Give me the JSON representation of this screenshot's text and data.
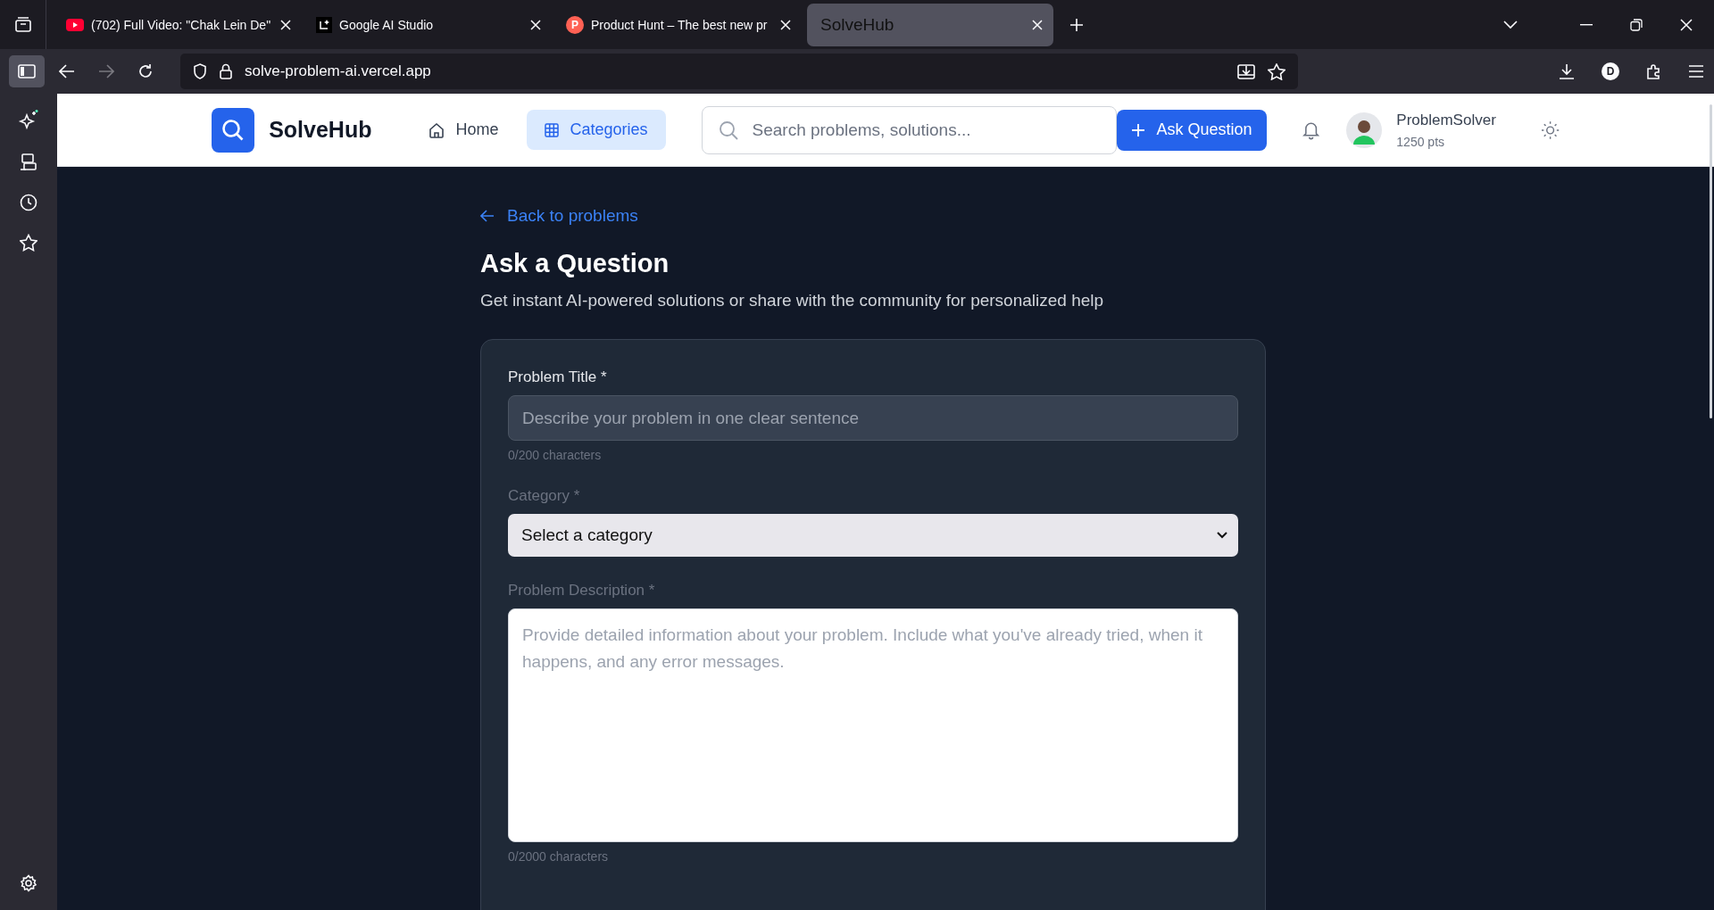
{
  "browser": {
    "tabs": [
      {
        "title": "(702) Full Video: \"Chak Lein De\"",
        "selected": false
      },
      {
        "title": "Google AI Studio",
        "selected": false
      },
      {
        "title": "Product Hunt – The best new pr",
        "icon_text": "P",
        "selected": false
      },
      {
        "title": "SolveHub",
        "selected": true
      }
    ],
    "url": "solve-problem-ai.vercel.app",
    "profile_initial": "D"
  },
  "header": {
    "brand": "SolveHub",
    "nav": [
      {
        "label": "Home",
        "selected": false
      },
      {
        "label": "Categories",
        "selected": true
      }
    ],
    "search": {
      "placeholder": "Search problems, solutions..."
    },
    "ask_button": "Ask Question",
    "user": {
      "name": "ProblemSolver",
      "points": "1250 pts"
    }
  },
  "page": {
    "back_link": "Back to problems",
    "title": "Ask a Question",
    "subtitle": "Get instant AI-powered solutions or share with the community for personalized help",
    "fields": [
      {
        "kind": "input",
        "label": "Problem Title *",
        "dimmed": false,
        "placeholder": "Describe your problem in one clear sentence",
        "counter": "0/200 characters"
      },
      {
        "kind": "select",
        "label": "Category *",
        "dimmed": true,
        "value": "Select a category"
      },
      {
        "kind": "textarea",
        "label": "Problem Description *",
        "dimmed": true,
        "placeholder": "Provide detailed information about your problem. Include what you've already tried, when it happens, and any error messages.",
        "counter": "0/2000 characters"
      }
    ]
  }
}
